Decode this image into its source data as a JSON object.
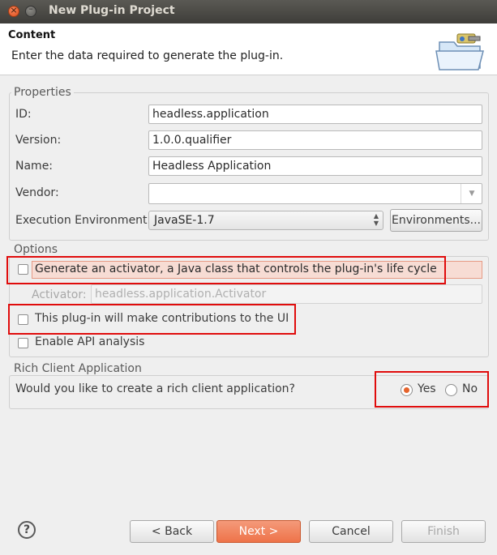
{
  "window": {
    "title": "New Plug-in Project",
    "close_glyph": "×",
    "min_glyph": "–"
  },
  "header": {
    "title": "Content",
    "description": "Enter the data required to generate the plug-in."
  },
  "properties": {
    "legend": "Properties",
    "id_label": "ID:",
    "id_value": "headless.application",
    "version_label": "Version:",
    "version_value": "1.0.0.qualifier",
    "name_label": "Name:",
    "name_value": "Headless Application",
    "vendor_label": "Vendor:",
    "vendor_value": "",
    "ee_label": "Execution Environment:",
    "ee_value": "JavaSE-1.7",
    "environments_button": "Environments..."
  },
  "options": {
    "legend": "Options",
    "generate_activator": {
      "label": "Generate an activator, a Java class that controls the plug-in's life cycle",
      "checked": false
    },
    "activator_label": "Activator:",
    "activator_value": "headless.application.Activator",
    "ui_contributions": {
      "label": "This plug-in will make contributions to the UI",
      "checked": false
    },
    "api_analysis": {
      "label": "Enable API analysis",
      "checked": false
    }
  },
  "rca": {
    "legend": "Rich Client Application",
    "question": "Would you like to create a rich client application?",
    "yes_label": "Yes",
    "no_label": "No",
    "selected": "Yes"
  },
  "footer": {
    "help_glyph": "?",
    "back": "< Back",
    "next": "Next >",
    "cancel": "Cancel",
    "finish": "Finish"
  },
  "colors": {
    "accent": "#ee7349",
    "highlight_border": "#e00c0c"
  }
}
